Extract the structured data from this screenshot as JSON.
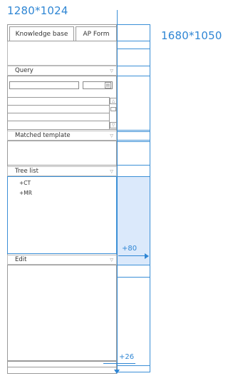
{
  "resolutions": {
    "small": "1280*1024",
    "large": "1680*1050"
  },
  "tabs": [
    {
      "label": "Knowledge base"
    },
    {
      "label": "AP Form"
    }
  ],
  "sections": {
    "query": "Query",
    "matched_template": "Matched template",
    "tree_list": "Tree list",
    "edit": "Edit"
  },
  "tree_items": [
    "+CT",
    "+MR"
  ],
  "annotations": {
    "width_delta": "+80",
    "height_delta": "+26"
  },
  "colors": {
    "accent": "#3b8fd6",
    "highlight": "#dbe9fb",
    "border": "#b9b9b9"
  },
  "icons": {
    "collapse": "chevron-down-icon",
    "scroll_up": "arrow-up-icon",
    "scroll_down": "arrow-down-icon"
  }
}
